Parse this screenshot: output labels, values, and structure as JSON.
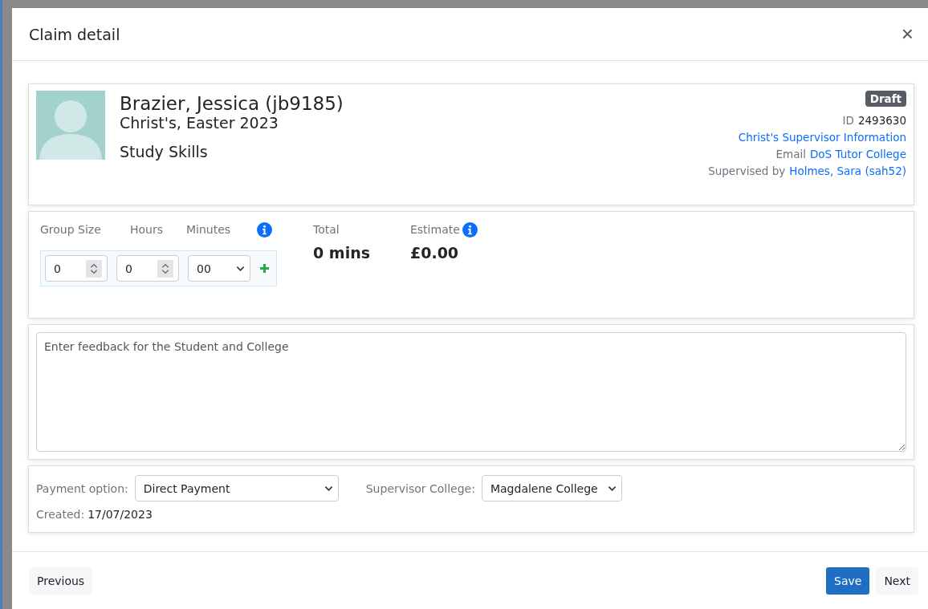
{
  "modal": {
    "title": "Claim detail",
    "close": "×"
  },
  "student": {
    "name": "Brazier, Jessica (jb9185)",
    "college_term": "Christ's, Easter 2023",
    "subject": "Study Skills",
    "status": "Draft",
    "id_label": "ID",
    "id": "2493630",
    "info_link": "Christ's Supervisor Information",
    "email_label": "Email",
    "email_link": "DoS Tutor College",
    "supervised_label": "Supervised by",
    "supervisor_link": "Holmes, Sara (sah52)"
  },
  "time_entry": {
    "labels": [
      "Group Size",
      "Hours",
      "Minutes"
    ],
    "group_size": "0",
    "hours": "0",
    "minutes": "00",
    "total_label": "Total",
    "total": "0 mins",
    "estimate_label": "Estimate",
    "estimate": "£0.00"
  },
  "feedback": {
    "placeholder": "Enter feedback for the Student and College"
  },
  "payment": {
    "option_label": "Payment option:",
    "option": "Direct Payment",
    "college_label": "Supervisor College:",
    "college": "Magdalene College",
    "created_label": "Created:",
    "created": "17/07/2023"
  },
  "footer": {
    "previous": "Previous",
    "save": "Save",
    "next": "Next"
  }
}
